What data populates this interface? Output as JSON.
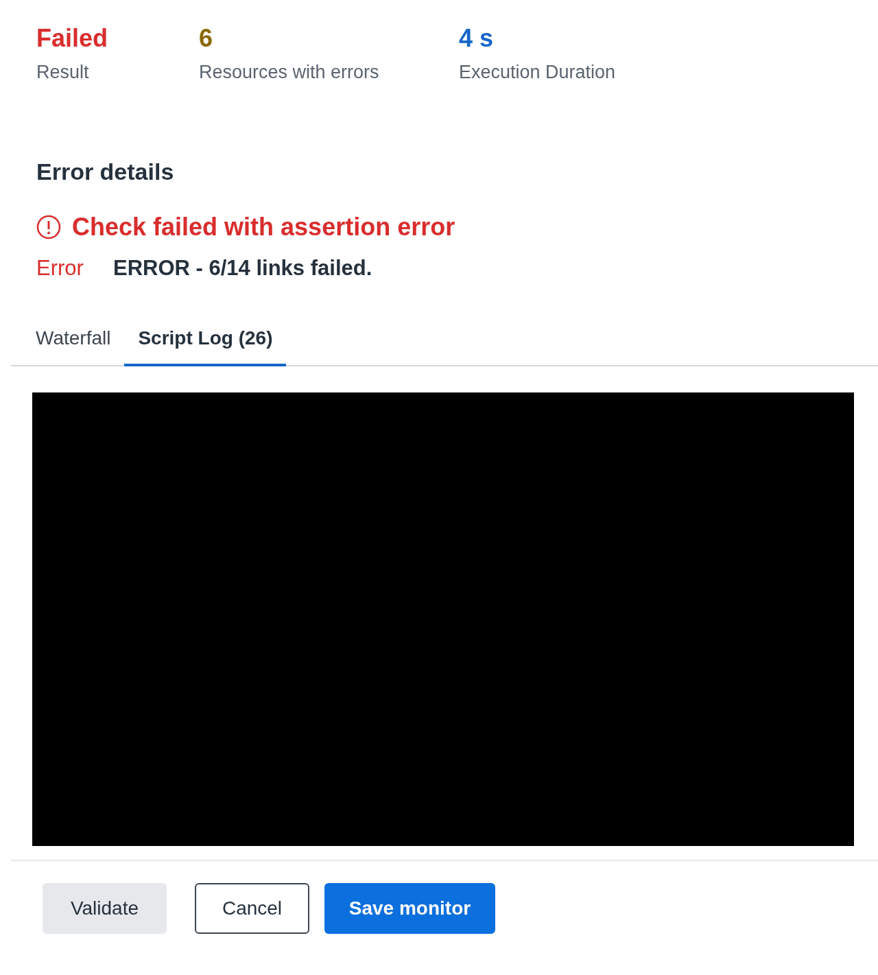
{
  "stats": [
    {
      "value": "Failed",
      "label": "Result",
      "color": "#d92d2d"
    },
    {
      "value": "6",
      "label": "Resources with errors",
      "color": "#8a6a0a"
    },
    {
      "value": "4 s",
      "label": "Execution Duration",
      "color": "#1766c8"
    }
  ],
  "error_details": {
    "heading": "Error details",
    "alert_title": "Check failed with assertion error",
    "error_label": "Error",
    "error_message": "ERROR - 6/14 links failed."
  },
  "tabs": [
    {
      "label": "Waterfall",
      "selected": false
    },
    {
      "label": "Script Log (26)",
      "selected": true
    }
  ],
  "log_panel": {
    "kind": "blank"
  },
  "buttons": [
    {
      "label": "Validate",
      "kind": "secondary"
    },
    {
      "label": "Cancel",
      "kind": "outline"
    },
    {
      "label": "Save monitor",
      "kind": "primary"
    }
  ]
}
